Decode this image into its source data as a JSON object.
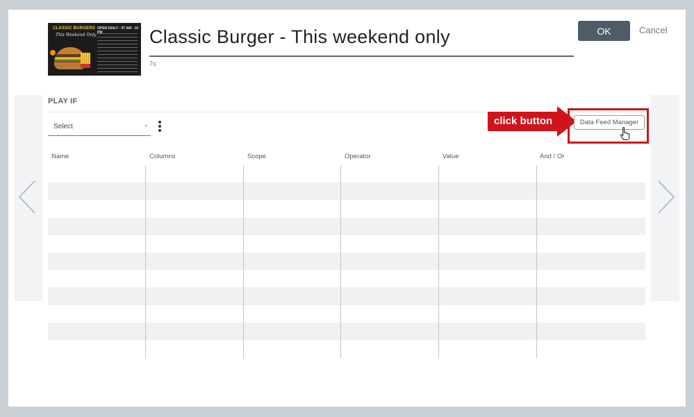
{
  "header": {
    "title": "Classic Burger - This weekend only",
    "duration": "7s",
    "ok_label": "OK",
    "cancel_label": "Cancel"
  },
  "thumbnail": {
    "brand": "CLASSIC BURGERS",
    "tagline": "This Weekend Only",
    "hours": "OPEN DAILY - 07 AM - 10 PM"
  },
  "play_if": {
    "section_label": "PLAY IF",
    "select_value": "Select"
  },
  "table": {
    "columns": [
      "Name",
      "Columns",
      "Scope",
      "Operator",
      "Value",
      "And / Or"
    ],
    "row_count": 11
  },
  "annotation": {
    "callout_text": "click button"
  },
  "toolbar": {
    "data_feed_manager_label": "Data Feed Manager"
  },
  "colors": {
    "accent": "#4f5b66",
    "annotation_red": "#d0141a",
    "row_alt": "#f1f1f1"
  },
  "icons": {
    "prev": "chevron-left-icon",
    "next": "chevron-right-icon",
    "more": "kebab-menu-icon",
    "pointer": "hand-cursor-icon"
  }
}
